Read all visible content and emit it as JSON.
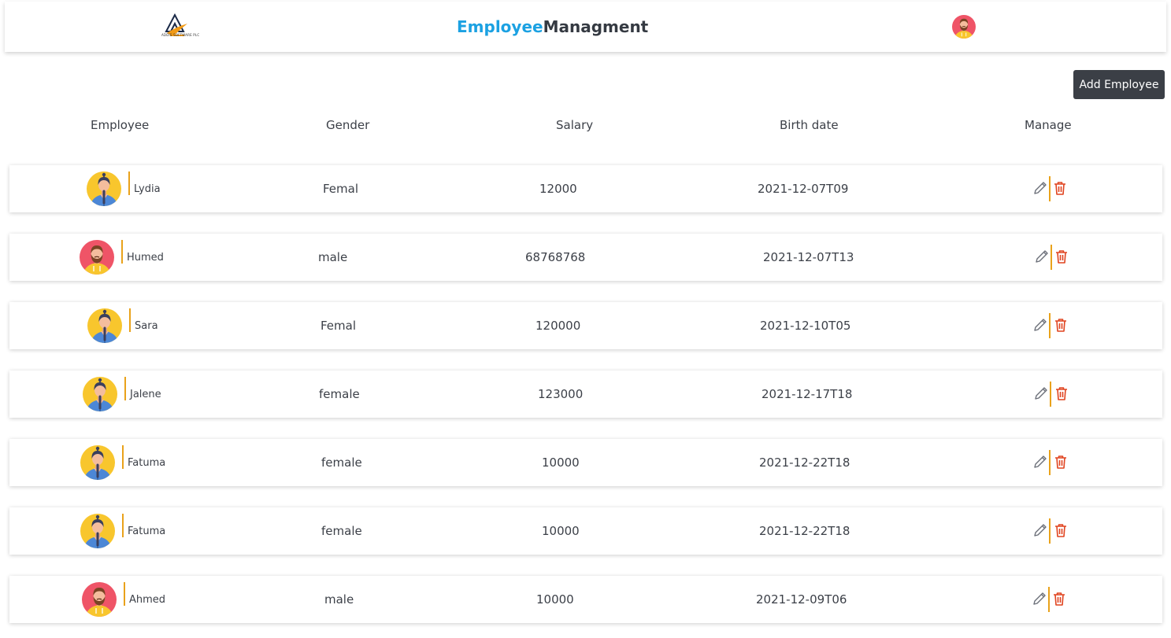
{
  "header": {
    "logo_text": "ADDIS SOFTWARE PLC",
    "brand_part1": "Employee",
    "brand_part2": "Managment"
  },
  "actions": {
    "add_employee": "Add Employee"
  },
  "table": {
    "columns": [
      "Employee",
      "Gender",
      "Salary",
      "Birth date",
      "Manage"
    ],
    "rows": [
      {
        "name": "Lydia",
        "gender": "Femal",
        "salary": "12000",
        "birth_date": "2021-12-07T09",
        "avatar": "female-avatar-icon"
      },
      {
        "name": "Humed",
        "gender": "male",
        "salary": "68768768",
        "birth_date": "2021-12-07T13",
        "avatar": "male-avatar-icon"
      },
      {
        "name": "Sara",
        "gender": "Femal",
        "salary": "120000",
        "birth_date": "2021-12-10T05",
        "avatar": "female-avatar-icon"
      },
      {
        "name": "Jalene",
        "gender": "female",
        "salary": "123000",
        "birth_date": "2021-12-17T18",
        "avatar": "female-avatar-icon"
      },
      {
        "name": "Fatuma",
        "gender": "female",
        "salary": "10000",
        "birth_date": "2021-12-22T18",
        "avatar": "female-avatar-icon"
      },
      {
        "name": "Fatuma",
        "gender": "female",
        "salary": "10000",
        "birth_date": "2021-12-22T18",
        "avatar": "female-avatar-icon"
      },
      {
        "name": "Ahmed",
        "gender": "male",
        "salary": "10000",
        "birth_date": "2021-12-09T06",
        "avatar": "male-avatar-icon"
      }
    ]
  },
  "colors": {
    "brand_blue": "#1ba1e2",
    "brand_dark": "#353a42",
    "button_bg": "#3b3f46",
    "divider_orange": "#e9a21b",
    "delete_red": "#e0431f"
  }
}
